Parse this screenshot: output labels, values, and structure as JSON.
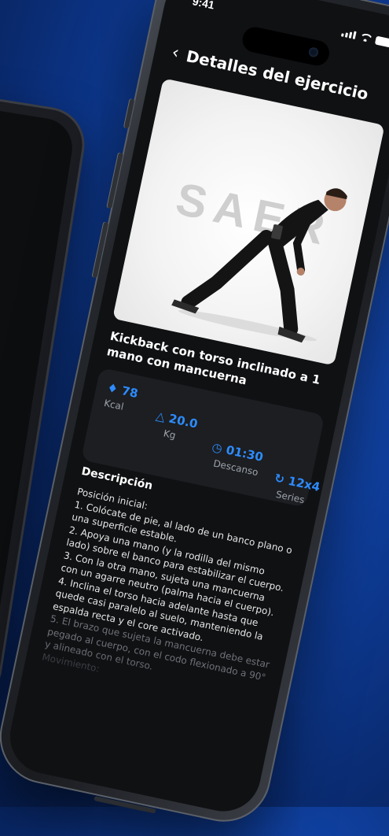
{
  "status_bar": {
    "time": "9:41"
  },
  "header": {
    "back_icon": "chevron-left-icon",
    "title": "Detalles del ejercicio"
  },
  "media": {
    "watermark": "SAER"
  },
  "exercise": {
    "name": "Kickback con torso inclinado a 1 mano con mancuerna"
  },
  "stats": [
    {
      "icon": "flame-icon",
      "value": "78",
      "label": "Kcal"
    },
    {
      "icon": "kettlebell-icon",
      "value": "20.0",
      "label": "Kg"
    },
    {
      "icon": "timer-icon",
      "value": "01:30",
      "label": "Descanso"
    },
    {
      "icon": "repeat-icon",
      "value": "12x4",
      "label": "Series"
    }
  ],
  "description": {
    "heading": "Descripción",
    "lines": [
      "Posición inicial:",
      "1. Colócate de pie, al lado de un banco plano o una superficie estable.",
      "2. Apoya una mano (y la rodilla del mismo lado) sobre el banco para estabilizar el cuerpo.",
      "3. Con la otra mano, sujeta una mancuerna con un agarre neutro (palma hacia el cuerpo).",
      "4. Inclina el torso hacia adelante hasta que quede casi paralelo al suelo, manteniendo la espalda recta y el core activado.",
      "5. El brazo que sujeta la mancuerna debe estar pegado al cuerpo, con el codo flexionado a 90° y alineado con el torso.",
      "Movimiento:"
    ]
  },
  "colors": {
    "accent": "#2d8cff",
    "background": "#101113",
    "card": "#1c1e22"
  }
}
